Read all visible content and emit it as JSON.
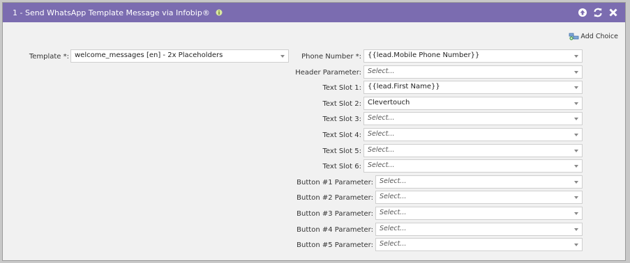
{
  "header": {
    "title": "1 - Send WhatsApp Template Message via Infobip®",
    "colors": {
      "bar": "#7b6cb0",
      "text": "#ffffff"
    },
    "icons": [
      "info-icon",
      "collapse-arrow-icon",
      "refresh-icon",
      "close-icon"
    ]
  },
  "add_choice": {
    "label": "Add Choice",
    "icon": "add-choice-icon"
  },
  "template": {
    "label": "Template *:",
    "value": "welcome_messages [en] - 2x Placeholders"
  },
  "fields": [
    {
      "label": "Phone Number *:",
      "value": "{{lead.Mobile Phone Number}}",
      "placeholder": false
    },
    {
      "label": "Header Parameter:",
      "value": "Select...",
      "placeholder": true
    },
    {
      "label": "Text Slot 1:",
      "value": "{{lead.First Name}}",
      "placeholder": false
    },
    {
      "label": "Text Slot 2:",
      "value": "Clevertouch",
      "placeholder": false
    },
    {
      "label": "Text Slot 3:",
      "value": "Select...",
      "placeholder": true
    },
    {
      "label": "Text Slot 4:",
      "value": "Select...",
      "placeholder": true
    },
    {
      "label": "Text Slot 5:",
      "value": "Select...",
      "placeholder": true
    },
    {
      "label": "Text Slot 6:",
      "value": "Select...",
      "placeholder": true
    },
    {
      "label": "Button #1 Parameter:",
      "value": "Select...",
      "placeholder": true
    },
    {
      "label": "Button #2 Parameter:",
      "value": "Select...",
      "placeholder": true
    },
    {
      "label": "Button #3 Parameter:",
      "value": "Select...",
      "placeholder": true
    },
    {
      "label": "Button #4 Parameter:",
      "value": "Select...",
      "placeholder": true
    },
    {
      "label": "Button #5 Parameter:",
      "value": "Select...",
      "placeholder": true
    }
  ]
}
